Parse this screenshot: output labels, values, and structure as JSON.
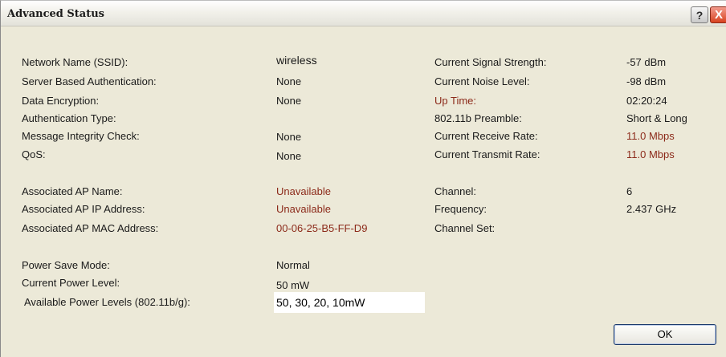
{
  "window": {
    "title": "Advanced Status"
  },
  "buttons": {
    "help": "?",
    "close": "X",
    "ok": "OK"
  },
  "left": {
    "ssid_label": "Network Name (SSID):",
    "ssid_value": "wireless",
    "auth_label": "Server Based Authentication:",
    "auth_value": "None",
    "enc_label": "Data Encryption:",
    "enc_value": "None",
    "authtype_label": "Authentication Type:",
    "authtype_value": "",
    "mic_label": "Message Integrity Check:",
    "mic_value": "None",
    "qos_label": "QoS:",
    "qos_value": "None",
    "ap_name_label": "Associated AP Name:",
    "ap_name_value": "Unavailable",
    "ap_ip_label": "Associated AP IP Address:",
    "ap_ip_value": "Unavailable",
    "ap_mac_label": "Associated AP MAC Address:",
    "ap_mac_value": "00-06-25-B5-FF-D9",
    "psm_label": "Power Save Mode:",
    "psm_value": "Normal",
    "cpl_label": "Current Power Level:",
    "cpl_value": "50 mW",
    "apl_label": "Available Power Levels (802.11b/g):",
    "apl_value": "50, 30, 20, 10mW"
  },
  "right": {
    "signal_label": "Current Signal Strength:",
    "signal_value": "-57 dBm",
    "noise_label": "Current Noise Level:",
    "noise_value": "-98 dBm",
    "uptime_label": "Up Time:",
    "uptime_value": "02:20:24",
    "preamble_label": "802.11b Preamble:",
    "preamble_value": "Short & Long",
    "rx_label": "Current Receive Rate:",
    "rx_value": "11.0 Mbps",
    "tx_label": "Current Transmit Rate:",
    "tx_value": "11.0 Mbps",
    "channel_label": "Channel:",
    "channel_value": "6",
    "freq_label": "Frequency:",
    "freq_value": "2.437 GHz",
    "chset_label": "Channel Set:",
    "chset_value": ""
  },
  "colors": {
    "dialog_bg": "#ece9d8",
    "accent_value": "#8c2a1a",
    "ok_border": "#1d3b6b"
  }
}
